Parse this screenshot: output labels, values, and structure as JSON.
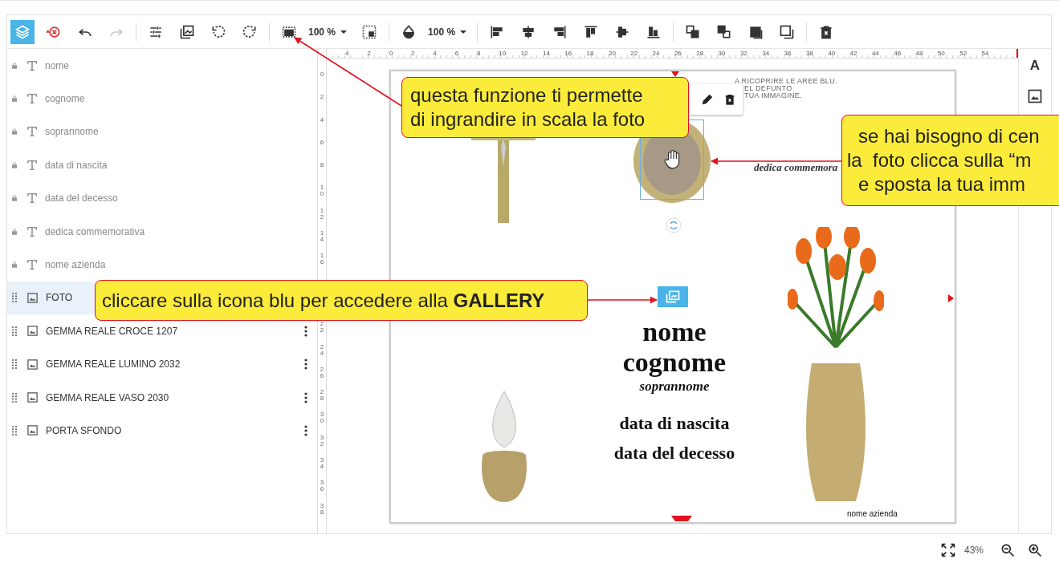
{
  "toolbar": {
    "layers_selected": true,
    "redo_disabled": true,
    "scale": "100 %",
    "opacity": "100 %"
  },
  "layers": [
    {
      "label": "nome",
      "kind": "text",
      "locked": true,
      "selected": false,
      "menu": false
    },
    {
      "label": "cognome",
      "kind": "text",
      "locked": true,
      "selected": false,
      "menu": false
    },
    {
      "label": "soprannome",
      "kind": "text",
      "locked": true,
      "selected": false,
      "menu": false
    },
    {
      "label": "data di nascita",
      "kind": "text",
      "locked": true,
      "selected": false,
      "menu": false
    },
    {
      "label": "data del decesso",
      "kind": "text",
      "locked": true,
      "selected": false,
      "menu": false
    },
    {
      "label": "dedica commemorativa",
      "kind": "text",
      "locked": true,
      "selected": false,
      "menu": false
    },
    {
      "label": "nome azienda",
      "kind": "text",
      "locked": true,
      "selected": false,
      "menu": false
    },
    {
      "label": "FOTO",
      "kind": "image",
      "locked": false,
      "selected": true,
      "menu": false
    },
    {
      "label": "GEMMA REALE CROCE 1207",
      "kind": "image",
      "locked": false,
      "selected": false,
      "menu": true
    },
    {
      "label": "GEMMA REALE LUMINO 2032",
      "kind": "image",
      "locked": false,
      "selected": false,
      "menu": true
    },
    {
      "label": "GEMMA REALE VASO 2030",
      "kind": "image",
      "locked": false,
      "selected": false,
      "menu": true
    },
    {
      "label": "PORTA SFONDO",
      "kind": "image",
      "locked": false,
      "selected": false,
      "menu": true
    }
  ],
  "ruler_h": [
    "4",
    "2",
    "0",
    "2",
    "4",
    "6",
    "8",
    "10",
    "12",
    "14",
    "16",
    "18",
    "20",
    "22",
    "24",
    "26",
    "28",
    "30",
    "32",
    "34",
    "36",
    "38",
    "40",
    "42",
    "44",
    "46",
    "48",
    "50",
    "52",
    "54"
  ],
  "ruler_v_upper": [
    "0",
    "2",
    "4",
    "6",
    "8",
    "10",
    "12",
    "14",
    "16"
  ],
  "ruler_v_lower": [
    "22",
    "24",
    "26",
    "28",
    "30",
    "32",
    "34",
    "36",
    "38"
  ],
  "canvas": {
    "hint_lines": [
      "A RICOPRIRE LE AREE BLU.",
      "EL DEFUNTO",
      "TUA IMMAGINE."
    ],
    "name": "nome",
    "surname": "cognome",
    "nickname": "soprannome",
    "birth": "data di nascita",
    "death": "data del decesso",
    "dedication": "dedica commemora",
    "company": "nome azienda"
  },
  "right_tools": {
    "text_tool": "A"
  },
  "zoom": "43%",
  "callouts": [
    {
      "lines": [
        "questa funzione ti permette",
        "di ingrandire in scala la foto"
      ]
    },
    {
      "lines": [
        "se hai bisogno di cen",
        "la  foto clicca sulla “m",
        "e sposta la tua imm"
      ]
    },
    {
      "lines": [
        "cliccare sulla icona blu per accedere alla **GALLERY**"
      ]
    }
  ]
}
